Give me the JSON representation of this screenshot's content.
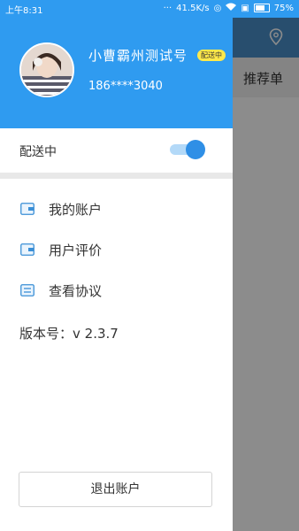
{
  "status_bar": {
    "time": "上午8:31",
    "network_speed": "41.5K/s",
    "battery": "75%"
  },
  "background_app": {
    "tab_label": "推荐单"
  },
  "profile": {
    "username": "小曹霸州测试号",
    "status_badge": "配送中",
    "phone": "186****3040"
  },
  "delivery_switch": {
    "label": "配送中",
    "on": true
  },
  "menu": {
    "items": [
      {
        "label": "我的账户",
        "icon": "wallet-icon"
      },
      {
        "label": "用户评价",
        "icon": "wallet-icon"
      },
      {
        "label": "查看协议",
        "icon": "document-icon"
      }
    ]
  },
  "version": "版本号：v 2.3.7",
  "logout_label": "退出账户",
  "colors": {
    "primary": "#2f9bf0",
    "badge": "#ffe94a",
    "toggle_knob": "#2f8fe6"
  }
}
